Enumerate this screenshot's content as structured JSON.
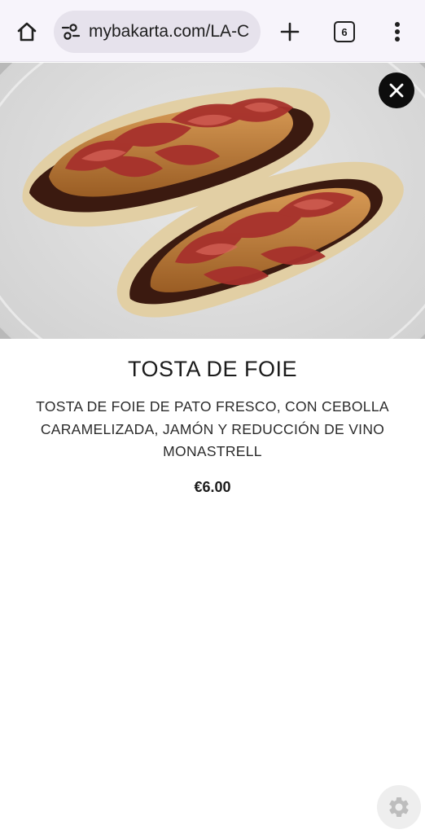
{
  "browser": {
    "url_display": "mybakarta.com/LA-C",
    "tab_count": "6",
    "icons": {
      "home": "home-icon",
      "site_settings": "tune-icon",
      "new_tab": "plus-icon",
      "tabs": "tabs-icon",
      "menu": "more-vert-icon"
    }
  },
  "product": {
    "image": "food-photo",
    "title": "TOSTA DE FOIE",
    "description": "TOSTA DE FOIE DE PATO FRESCO, CON CEBOLLA CARAMELIZADA, JAMÓN Y REDUCCIÓN DE VINO MONASTRELL",
    "price": "€6.00"
  },
  "overlay": {
    "close_icon": "close-icon",
    "settings_icon": "gear-icon"
  },
  "colors": {
    "toolbar_bg": "#f7f4fb",
    "url_pill_bg": "#e6e2ec",
    "close_btn_bg": "#0d0d0d",
    "fab_bg": "#eeeeee",
    "text": "#1b1b1b"
  }
}
